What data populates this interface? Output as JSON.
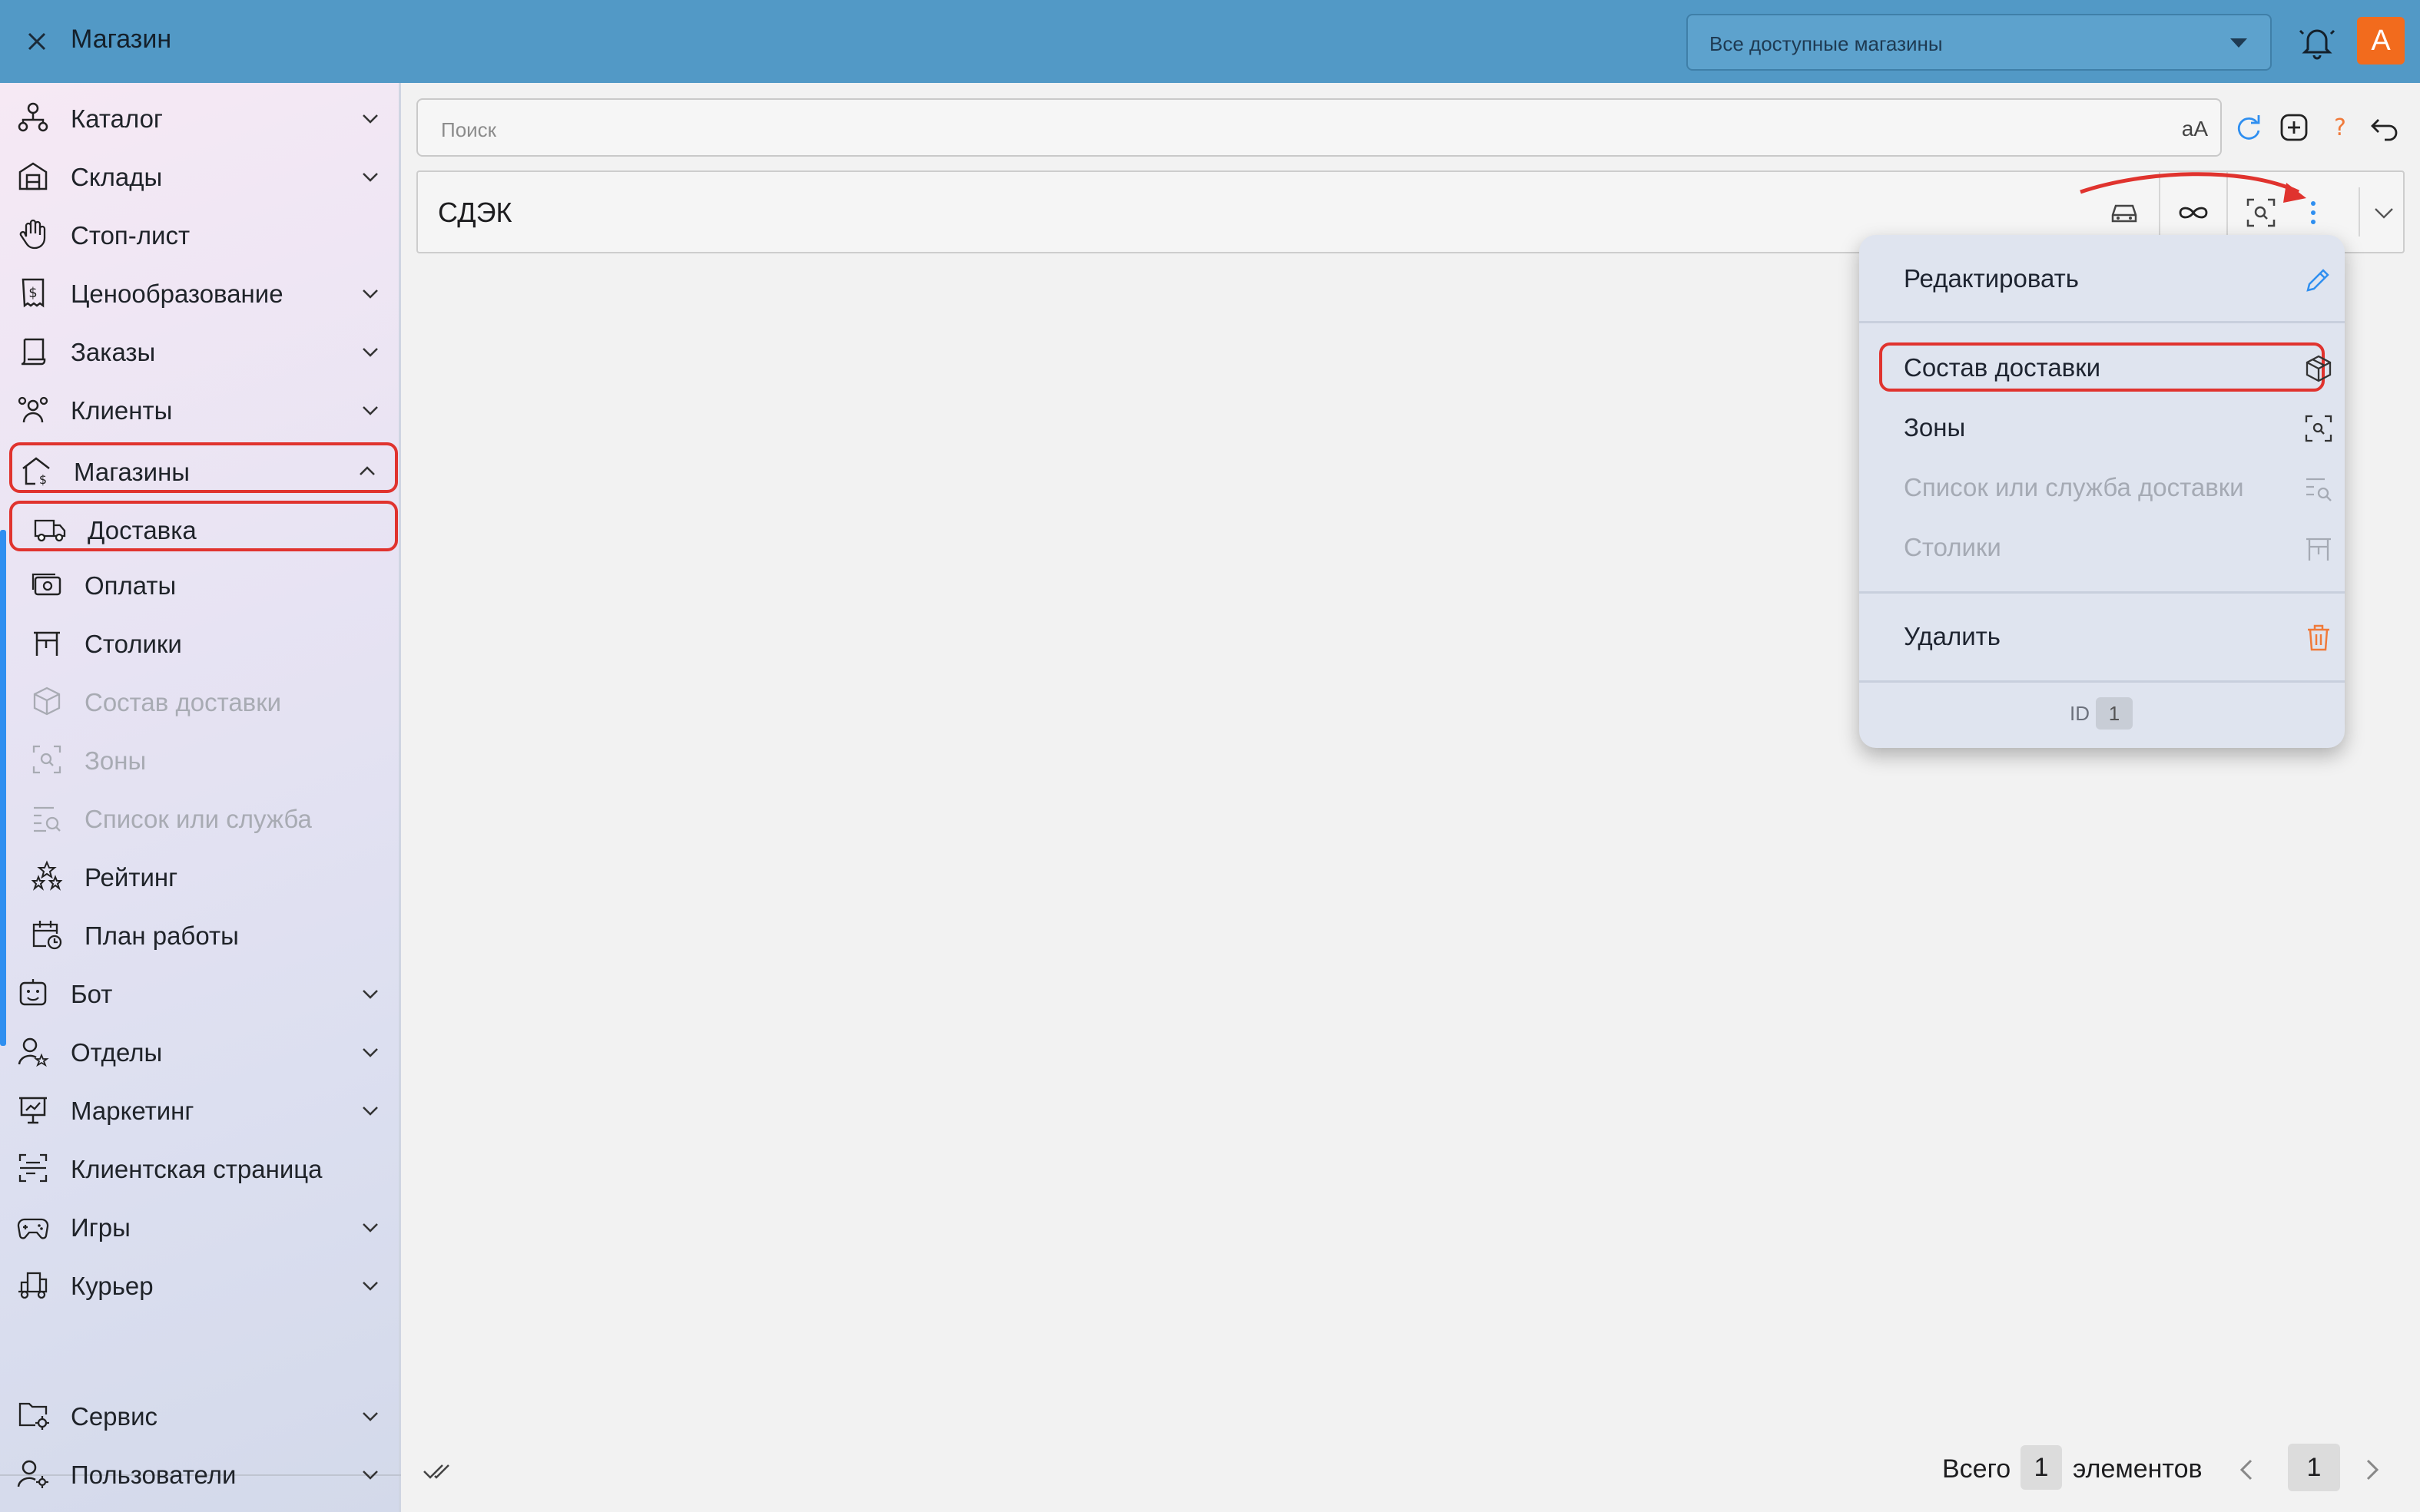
{
  "topbar": {
    "title": "Магазин",
    "store_select": "Все доступные магазины",
    "avatar_letter": "A"
  },
  "sidebar": {
    "items": [
      {
        "label": "Каталог",
        "icon": "catalog-icon",
        "expandable": true
      },
      {
        "label": "Склады",
        "icon": "warehouse-icon",
        "expandable": true
      },
      {
        "label": "Стоп-лист",
        "icon": "hand-stop-icon",
        "expandable": false
      },
      {
        "label": "Ценообразование",
        "icon": "price-receipt-icon",
        "expandable": true
      },
      {
        "label": "Заказы",
        "icon": "orders-scroll-icon",
        "expandable": true
      },
      {
        "label": "Клиенты",
        "icon": "clients-icon",
        "expandable": true
      },
      {
        "label": "Магазины",
        "icon": "shop-house-icon",
        "expandable": true,
        "expanded": true
      },
      {
        "label": "Доставка",
        "icon": "delivery-truck-icon",
        "sub": true
      },
      {
        "label": "Оплаты",
        "icon": "payment-cash-icon",
        "sub": true
      },
      {
        "label": "Столики",
        "icon": "table-icon",
        "sub": true
      },
      {
        "label": "Состав доставки",
        "icon": "package-box-icon",
        "sub": true,
        "disabled": true
      },
      {
        "label": "Зоны",
        "icon": "zone-scan-icon",
        "sub": true,
        "disabled": true
      },
      {
        "label": "Список или служба",
        "icon": "list-search-icon",
        "sub": true,
        "disabled": true
      },
      {
        "label": "Рейтинг",
        "icon": "rating-stars-icon",
        "sub": true
      },
      {
        "label": "План работы",
        "icon": "calendar-clock-icon",
        "sub": true
      },
      {
        "label": "Бот",
        "icon": "bot-face-icon",
        "expandable": true
      },
      {
        "label": "Отделы",
        "icon": "departments-user-icon",
        "expandable": true
      },
      {
        "label": "Маркетинг",
        "icon": "marketing-board-icon",
        "expandable": true
      },
      {
        "label": "Клиентская страница",
        "icon": "client-page-icon",
        "expandable": false
      },
      {
        "label": "Игры",
        "icon": "gamepad-icon",
        "expandable": true
      },
      {
        "label": "Курьер",
        "icon": "courier-cart-icon",
        "expandable": true
      }
    ],
    "bottom_items": [
      {
        "label": "Сервис",
        "icon": "service-folder-icon",
        "expandable": true
      },
      {
        "label": "Пользователи",
        "icon": "users-settings-icon",
        "expandable": true
      }
    ]
  },
  "search": {
    "placeholder": "Поиск",
    "case_toggle": "aA"
  },
  "row": {
    "name": "СДЭК"
  },
  "menu": {
    "edit": "Редактировать",
    "composition": "Состав доставки",
    "zones": "Зоны",
    "list_service": "Список или служба доставки",
    "tables": "Столики",
    "delete": "Удалить",
    "id_label": "ID",
    "id_value": "1"
  },
  "footer": {
    "total_label": "Всего",
    "total_value": "1",
    "elements_label": "элементов",
    "page": "1"
  },
  "colors": {
    "topbar": "#5299c6",
    "accent": "#2f8ff0",
    "avatar": "#f26b1d",
    "highlight": "#e0332e",
    "delete": "#f07a3a"
  }
}
